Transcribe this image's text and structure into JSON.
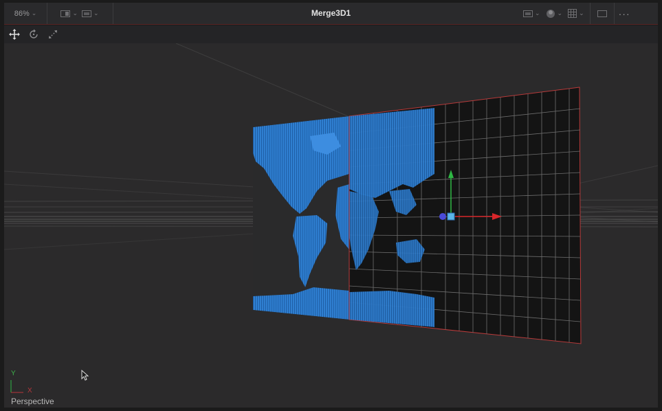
{
  "toolbar": {
    "zoom_value": "86%",
    "title": "Merge3D1",
    "left_icons": [
      "view-layout-icon",
      "frame-icon"
    ],
    "right_icons": [
      "display-options-icon",
      "lighting-icon",
      "grid-icon",
      "single-view-icon",
      "more-icon"
    ],
    "more_label": "···"
  },
  "tools": [
    "move-tool-icon",
    "rotate-tool-icon",
    "scale-tool-icon"
  ],
  "viewport": {
    "camera_label": "Perspective",
    "axis_y_label": "Y",
    "axis_x_label": "X",
    "colors": {
      "map": "#2f7fd1",
      "plane_outline": "#b83a3a",
      "gizmo_x": "#d8262a",
      "gizmo_y": "#2fb844",
      "gizmo_z": "#3a78d8",
      "grid_line": "#6e6e6e"
    }
  }
}
